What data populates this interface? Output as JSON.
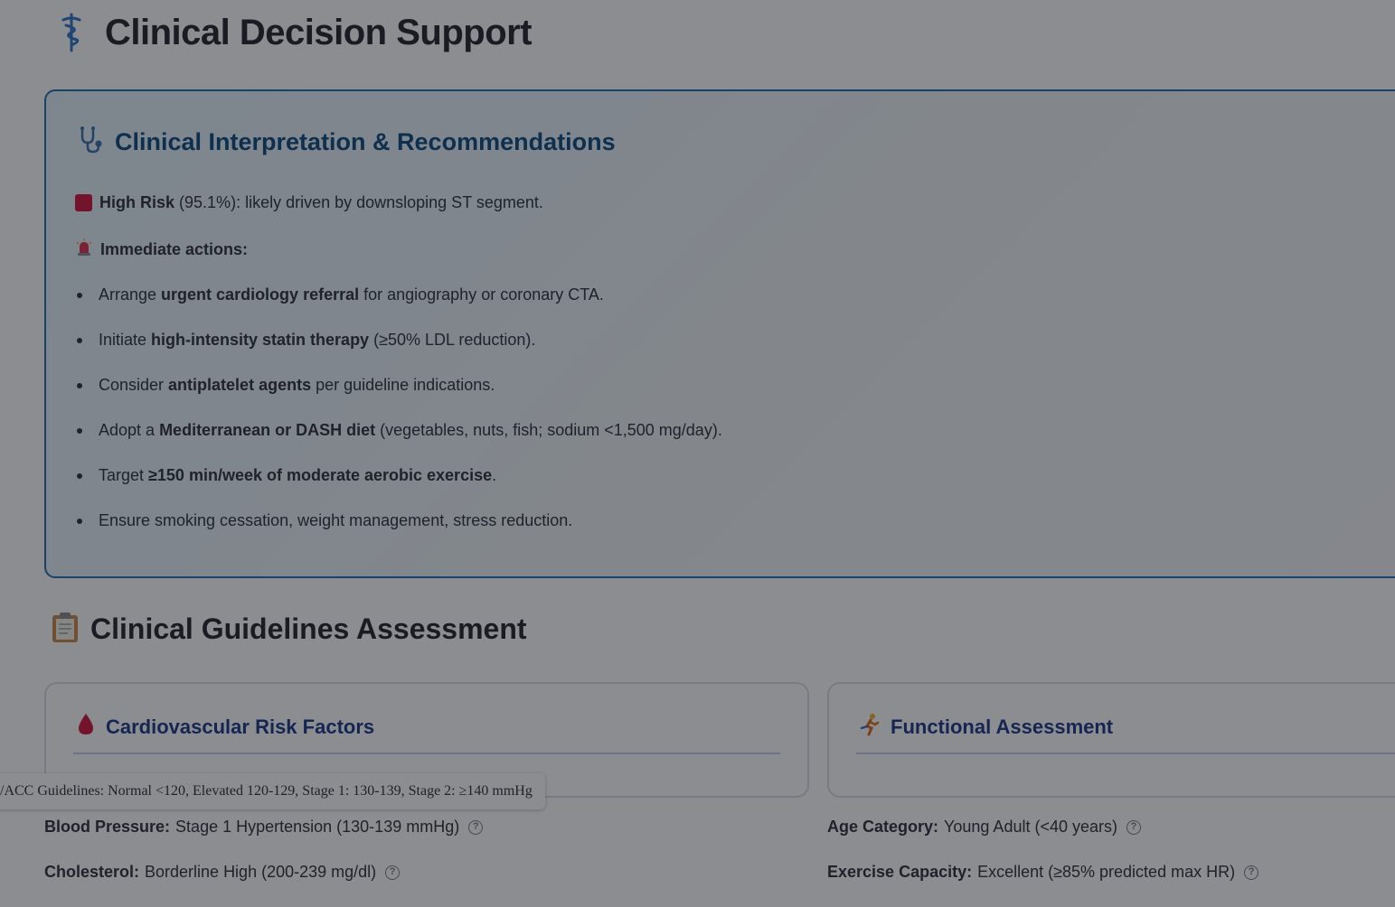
{
  "page": {
    "title": "Clinical Decision Support",
    "title_icon": "caduceus-icon"
  },
  "interpretation": {
    "heading": "Clinical Interpretation & Recommendations",
    "heading_icon": "stethoscope-icon",
    "risk": {
      "label": "High Risk",
      "percent": "(95.1%)",
      "reason": ": likely driven by downsloping ST segment.",
      "color": "#d01840"
    },
    "actions_label": "Immediate actions:",
    "actions_icon": "siren-icon",
    "recommendations": [
      {
        "pre": "Arrange ",
        "bold": "urgent cardiology referral",
        "post": " for angiography or coronary CTA."
      },
      {
        "pre": "Initiate ",
        "bold": "high-intensity statin therapy",
        "post": " (≥50% LDL reduction)."
      },
      {
        "pre": "Consider ",
        "bold": "antiplatelet agents",
        "post": " per guideline indications."
      },
      {
        "pre": "Adopt a ",
        "bold": "Mediterranean or DASH diet",
        "post": " (vegetables, nuts, fish; sodium <1,500 mg/day)."
      },
      {
        "pre": "Target ",
        "bold": "≥150 min/week of moderate aerobic exercise",
        "post": "."
      },
      {
        "pre": "Ensure smoking cessation, weight management, stress reduction.",
        "bold": "",
        "post": ""
      }
    ]
  },
  "guidelines": {
    "heading": "Clinical Guidelines Assessment",
    "heading_icon": "clipboard-icon",
    "cards": {
      "cardiovascular": {
        "title": "Cardiovascular Risk Factors",
        "icon": "blood-drop-icon"
      },
      "functional": {
        "title": "Functional Assessment",
        "icon": "runner-icon"
      }
    },
    "tooltip": "/ACC Guidelines: Normal <120, Elevated 120-129, Stage 1: 130-139, Stage 2: ≥140 mmHg",
    "metrics": {
      "blood_pressure": {
        "label": "Blood Pressure:",
        "value": "Stage 1 Hypertension (130-139 mmHg)"
      },
      "cholesterol": {
        "label": "Cholesterol:",
        "value": "Borderline High (200-239 mg/dl)"
      },
      "age_category": {
        "label": "Age Category:",
        "value": "Young Adult (<40 years)"
      },
      "exercise_capacity": {
        "label": "Exercise Capacity:",
        "value": "Excellent (≥85% predicted max HR)"
      }
    }
  },
  "colors": {
    "accent": "#1f6fb5",
    "heading_blue": "#0f4c81",
    "card_title": "#1e3a8a"
  }
}
